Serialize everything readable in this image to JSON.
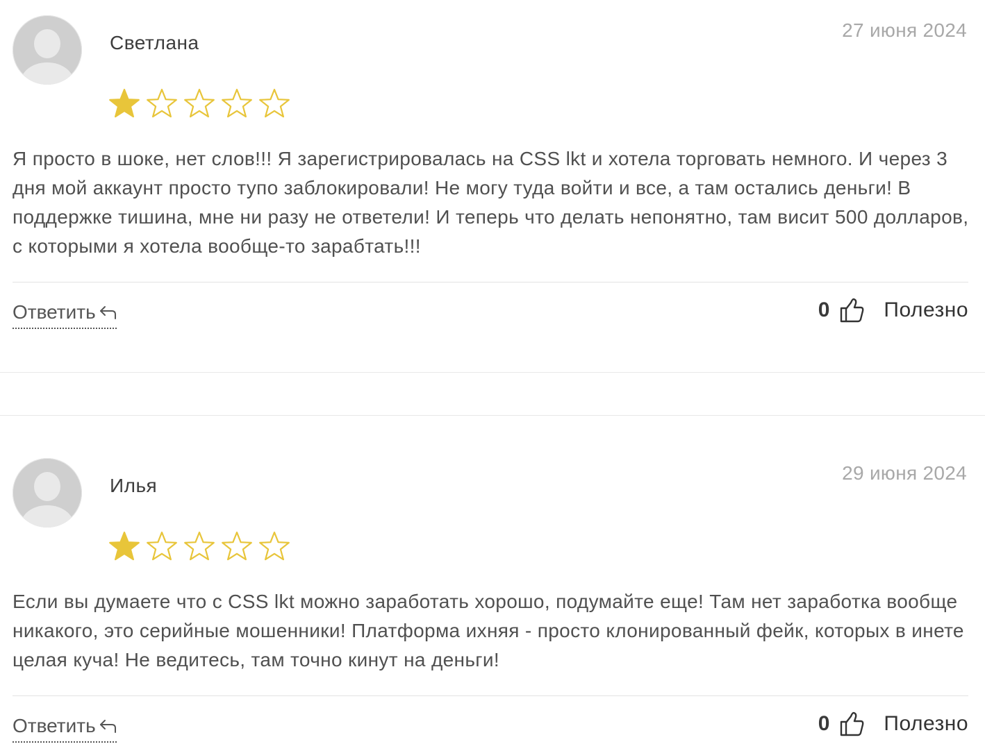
{
  "colors": {
    "star_fill": "#e8c53a",
    "star_stroke": "#e8c53a",
    "text": "#505050",
    "date": "#a8a8a8"
  },
  "reviews": [
    {
      "author": "Светлана",
      "date": "27 июня 2024",
      "rating": 1,
      "rating_max": 5,
      "text": "Я просто в шоке, нет слов!!! Я зарегистрировалась на CSS lkt и хотела торговать немного. И через 3 дня мой аккаунт просто тупо заблокировали! Не могу туда войти и все, а там остались деньги! В поддержке тишина, мне ни разу не ответели! И теперь что делать непонятно, там висит 500 долларов, с которыми я хотела вообще-то зарабтать!!!",
      "reply_label": "Ответить",
      "helpful_count": "0",
      "helpful_label": "Полезно"
    },
    {
      "author": "Илья",
      "date": "29 июня 2024",
      "rating": 1,
      "rating_max": 5,
      "text": "Если вы думаете что с CSS lkt можно заработать хорошо, подумайте еще! Там нет заработка вообще никакого, это серийные мошенники! Платформа ихняя - просто клонированный фейк, которых в инете целая куча! Не ведитесь, там точно кинут на деньги!",
      "reply_label": "Ответить",
      "helpful_count": "0",
      "helpful_label": "Полезно"
    }
  ]
}
